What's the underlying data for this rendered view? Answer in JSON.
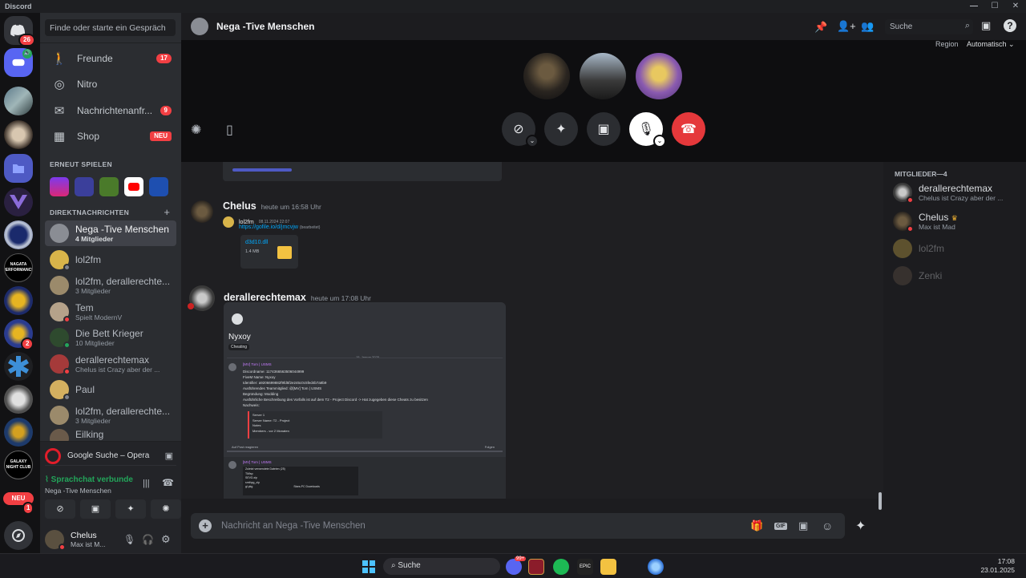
{
  "window": {
    "title": "Discord",
    "controls": [
      "—",
      "☐",
      "✕"
    ]
  },
  "rail": {
    "servers": [
      {
        "name": "Direktnachrichten",
        "badge": "26"
      },
      {
        "name": "Server Voice",
        "badge": ""
      },
      {
        "name": "Server",
        "badge": ""
      },
      {
        "name": "Server",
        "badge": ""
      },
      {
        "name": "Ordner",
        "badge": ""
      },
      {
        "name": "Server",
        "badge": ""
      },
      {
        "name": "Server",
        "badge": ""
      },
      {
        "name": "NAGATA PERFORMANCE",
        "badge": ""
      },
      {
        "name": "Server",
        "badge": ""
      },
      {
        "name": "Server",
        "badge": "2"
      },
      {
        "name": "Server",
        "badge": ""
      },
      {
        "name": "Server",
        "badge": ""
      },
      {
        "name": "Server",
        "badge": ""
      },
      {
        "name": "GALAXY NIGHT CLUB",
        "badge": ""
      }
    ],
    "new_label": "NEU",
    "new_badge": "1"
  },
  "sidebar": {
    "search_placeholder": "Finde oder starte ein Gespräch",
    "nav": [
      {
        "label": "Freunde",
        "badge": "17"
      },
      {
        "label": "Nitro",
        "badge": ""
      },
      {
        "label": "Nachrichtenanfr...",
        "badge": "9"
      },
      {
        "label": "Shop",
        "badge": "NEU"
      }
    ],
    "recently_played_title": "ERNEUT SPIELEN",
    "dm_title": "DIREKTNACHRICHTEN",
    "dm_add": "+",
    "dms": [
      {
        "name": "Nega -Tive Menschen",
        "sub": "4 Mitglieder",
        "status": ""
      },
      {
        "name": "lol2fm",
        "sub": "",
        "status": "offline"
      },
      {
        "name": "lol2fm, derallerechte...",
        "sub": "3 Mitglieder",
        "status": ""
      },
      {
        "name": "Tem",
        "sub": "Spielt ModernV",
        "status": "dnd"
      },
      {
        "name": "Die Bett Krieger",
        "sub": "10 Mitglieder",
        "status": "online"
      },
      {
        "name": "derallerechtemax",
        "sub": "Chelus ist Crazy aber der ...",
        "status": "dnd"
      },
      {
        "name": "Paul",
        "sub": "",
        "status": "offline"
      },
      {
        "name": "lol2fm, derallerechte...",
        "sub": "3 Mitglieder",
        "status": ""
      },
      {
        "name": "Eilking",
        "sub": "",
        "status": ""
      }
    ],
    "activity": {
      "label": "Google Suche – Opera"
    },
    "voice": {
      "status": "Sprachchat verbunde",
      "channel": "Nega -Tive Menschen"
    },
    "user": {
      "name": "Chelus",
      "status": "Max ist M..."
    }
  },
  "header": {
    "title": "Nega -Tive Menschen",
    "search_placeholder": "Suche",
    "region_label": "Region",
    "region_value": "Automatisch"
  },
  "chat": {
    "messages": [
      {
        "author": "Chelus",
        "time": "heute um 16:58 Uhr",
        "embed": {
          "from": "lol2fm",
          "date": "08.11.2024 22:07",
          "link": "https://gofile.io/d/jmcvjw",
          "edited": "(bearbeitet)",
          "file": "d3d10.dll",
          "size": "1.4 MB"
        }
      },
      {
        "author": "derallerechtemax",
        "time": "heute um 17:08 Uhr",
        "screenshot": {
          "channel": "Nyxoy",
          "tag": "Cheating",
          "date_sep": "15. Januar 2025",
          "poster": "[MV] Tom | USMS",
          "lines": [
            "Discordname: 1174366563506044999",
            "FiveM Name: Nyxoy",
            "Identifier: a9206699882f9fd5f2e245c0c5fed4b7a8b9",
            "Ausführendes Teammitglied: @[MV] Tom | USMS",
            "Begründung: Modding",
            "Ausführliche Beschreibung des Vorfalls ist auf dem T2 - Project Discord -> Hat zugegeben diese Cheats zu besitzen",
            "Nachweis:"
          ],
          "box": [
            "Server 1",
            "Server Name: T2 - Project",
            "Notes",
            "Members - vor 2 Monaten"
          ],
          "react": "Auf Post reagieren",
          "follow": "Folgen",
          "poster2": "[MV] Tom | USMS",
          "table_title": "Zuletzt verwendete Dateien (25)",
          "files": [
            "TMlsp",
            "SEVD.zip",
            "smthpg_zip",
            "gl.pkg"
          ],
          "file_status": "Stars-PC Downloads"
        }
      }
    ],
    "composer_placeholder": "Nachricht an Nega -Tive Menschen"
  },
  "members": {
    "title": "MITGLIEDER—4",
    "list": [
      {
        "name": "derallerechtemax",
        "status": "Chelus ist Crazy aber der ...",
        "dim": false
      },
      {
        "name": "Chelus",
        "status": "Max ist Mad",
        "dim": false,
        "owner": true
      },
      {
        "name": "lol2fm",
        "status": "",
        "dim": true
      },
      {
        "name": "Zenki",
        "status": "",
        "dim": true
      }
    ]
  },
  "taskbar": {
    "search_label": "Suche",
    "discord_badge": "99+",
    "time": "17:08",
    "date": "23.01.2025"
  },
  "colors": {
    "accent": "#5865f2",
    "danger": "#f23f43",
    "online": "#23a55a",
    "call_end": "#e5383b"
  }
}
